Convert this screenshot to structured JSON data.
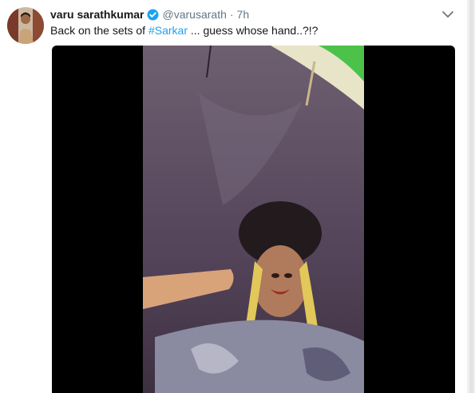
{
  "user": {
    "display_name": "varu sarathkumar",
    "handle": "@varusarath",
    "separator": "·",
    "time": "7h"
  },
  "tweet": {
    "text_before": "Back on the sets of ",
    "hashtag": "#Sarkar",
    "text_after": " ... guess whose hand..?!?"
  },
  "icons": {
    "verified": "verified-badge-icon",
    "menu": "chevron-down-icon"
  },
  "colors": {
    "link": "#1da1f2",
    "secondary_text": "#657786",
    "media_background": "#000000"
  }
}
